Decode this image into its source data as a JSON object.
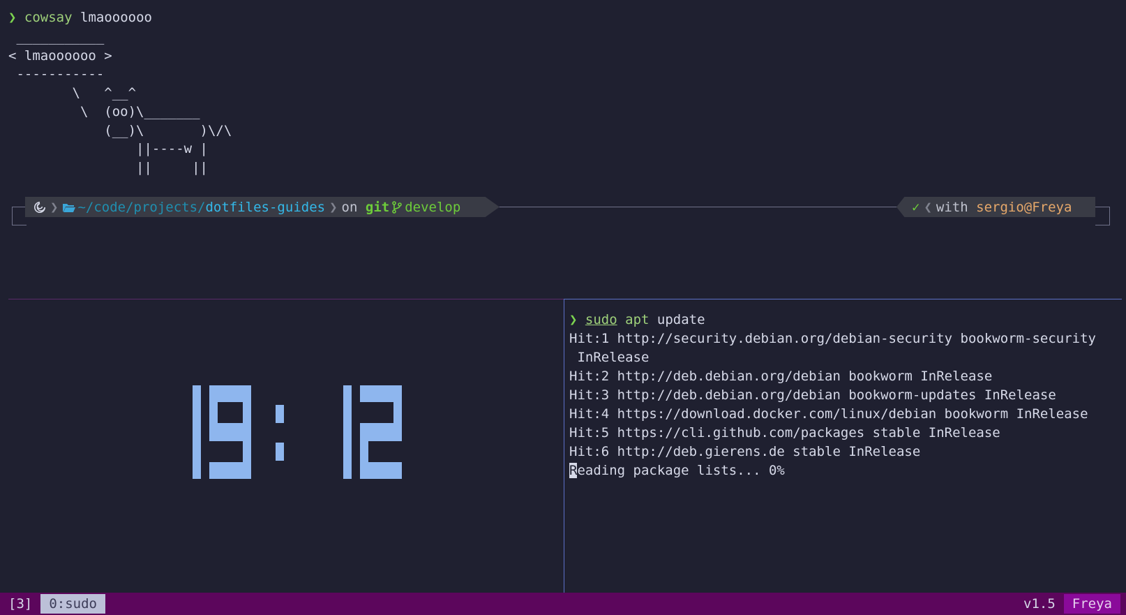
{
  "top_pane": {
    "prompt_symbol": "❯",
    "command": "cowsay",
    "argument": "lmaoooooo",
    "cow_output": " ___________\n< lmaoooooo >\n -----------\n        \\   ^__^\n         \\  (oo)\\_______\n            (__)\\       )\\/\\\n                ||----w |\n                ||     ||"
  },
  "powerline": {
    "os_icon": "debian-icon",
    "folder_icon": "folder-open-icon",
    "path_prefix": "~/code/projects/",
    "path_dir": "dotfiles-guides",
    "on_label": "on",
    "vcs_label": "git",
    "branch_icon": "git-branch-icon",
    "branch": "develop",
    "status_ok": "✓",
    "with_label": "with",
    "user_host": "sergio@Freya"
  },
  "clock": {
    "time": "19:12"
  },
  "apt_pane": {
    "prompt_symbol": "❯",
    "sudo": "sudo",
    "apt": "apt",
    "args": "update",
    "lines": [
      "Hit:1 http://security.debian.org/debian-security bookworm-security",
      " InRelease",
      "Hit:2 http://deb.debian.org/debian bookworm InRelease",
      "Hit:3 http://deb.debian.org/debian bookworm-updates InRelease",
      "Hit:4 https://download.docker.com/linux/debian bookworm InRelease",
      "Hit:5 https://cli.github.com/packages stable InRelease",
      "Hit:6 http://deb.gierens.de stable InRelease"
    ],
    "last_line_cursor": "R",
    "last_line_rest": "eading package lists... 0%"
  },
  "status_bar": {
    "session": "[3]",
    "window": "0:sudo",
    "version": "v1.5",
    "host": "Freya"
  },
  "colors": {
    "background": "#1f2030",
    "prompt_green": "#7cd450",
    "clock_blue": "#8eb6ee",
    "status_bar": "#5c065c",
    "status_host": "#8a0a9a"
  }
}
